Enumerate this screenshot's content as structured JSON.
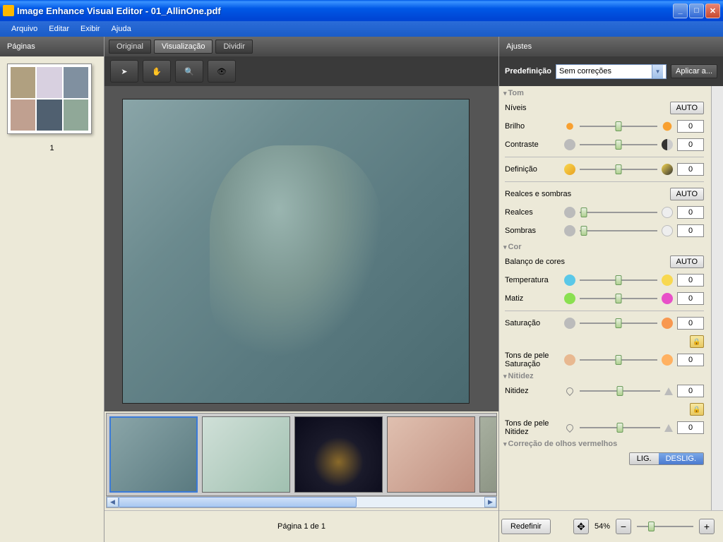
{
  "window": {
    "title": "Image Enhance Visual Editor - 01_AllinOne.pdf"
  },
  "menu": {
    "arquivo": "Arquivo",
    "editar": "Editar",
    "exibir": "Exibir",
    "ajuda": "Ajuda"
  },
  "sidebar": {
    "header": "Páginas",
    "pageNum": "1"
  },
  "tabs": {
    "original": "Original",
    "visualizacao": "Visualização",
    "dividir": "Dividir"
  },
  "panel": {
    "header": "Ajustes",
    "presetLabel": "Predefinição",
    "presetValue": "Sem correções",
    "applyLabel": "Aplicar a..."
  },
  "sections": {
    "tom": "Tom",
    "cor": "Cor",
    "nitidez": "Nitidez",
    "redeye": "Correção de olhos vermelhos"
  },
  "controls": {
    "niveis": "Níveis",
    "brilho": "Brilho",
    "contraste": "Contraste",
    "definicao": "Definição",
    "realcesSombras": "Realces e sombras",
    "realces": "Realces",
    "sombras": "Sombras",
    "balanco": "Balanço de cores",
    "temperatura": "Temperatura",
    "matiz": "Matiz",
    "saturacao": "Saturação",
    "tonsPeleSat": "Tons de pele Saturação",
    "nitidez": "Nitidez",
    "tonsPeleNit": "Tons de pele Nitidez",
    "auto": "AUTO",
    "lig": "LIG.",
    "deslig": "DESLIG."
  },
  "values": {
    "brilho": "0",
    "contraste": "0",
    "definicao": "0",
    "realces": "0",
    "sombras": "0",
    "temperatura": "0",
    "matiz": "0",
    "saturacao": "0",
    "tonsPeleSat": "0",
    "nitidez": "0",
    "tonsPeleNit": "0"
  },
  "bottom": {
    "pageInfo": "Página 1 de 1",
    "redefine": "Redefinir",
    "zoomPct": "54%"
  }
}
